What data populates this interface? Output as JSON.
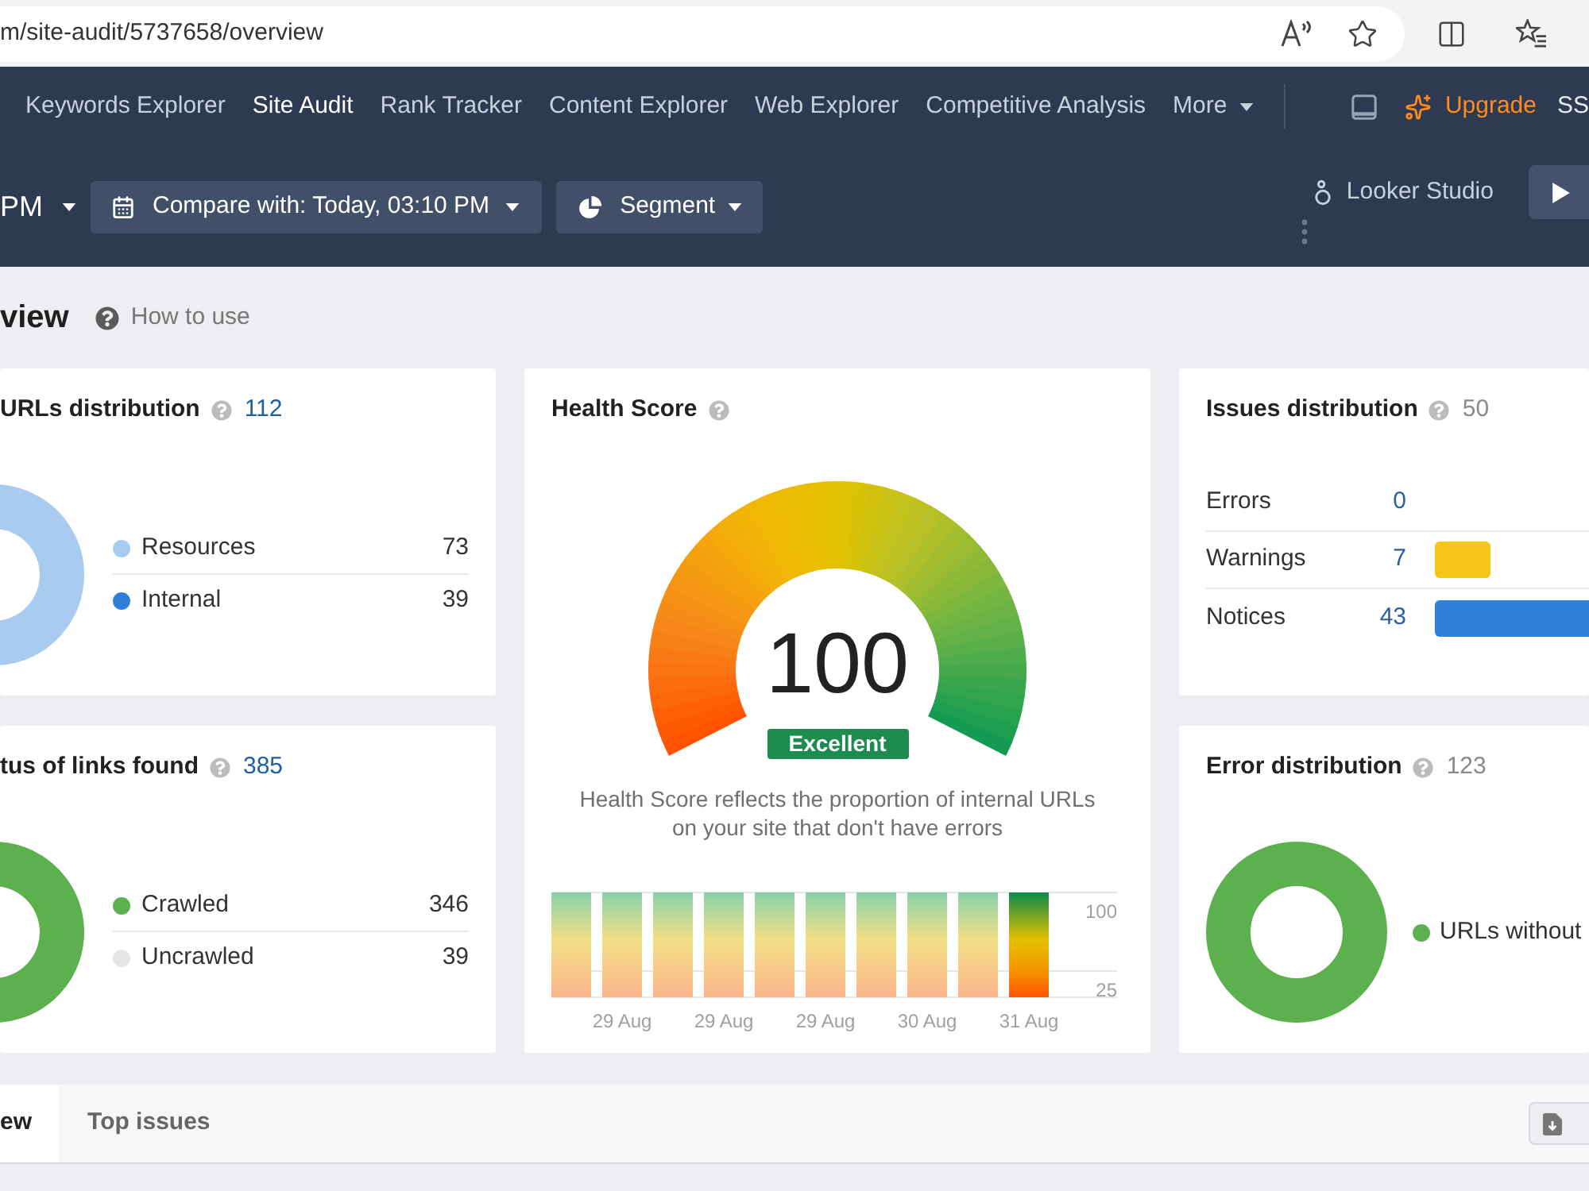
{
  "browser": {
    "url": "m/site-audit/5737658/overview"
  },
  "nav": {
    "items": [
      {
        "label": "Keywords Explorer",
        "kind": "link",
        "selected": false
      },
      {
        "label": "Site Audit",
        "kind": "link",
        "selected": true
      },
      {
        "label": "Rank Tracker",
        "kind": "link",
        "selected": false
      },
      {
        "label": "Content Explorer",
        "kind": "link",
        "selected": false
      },
      {
        "label": "Web Explorer",
        "kind": "link",
        "selected": false
      },
      {
        "label": "Competitive Analysis",
        "kind": "link",
        "selected": false
      },
      {
        "label": "More",
        "kind": "menu",
        "selected": false
      }
    ],
    "upgrade": "Upgrade",
    "account": "SS"
  },
  "toolbar": {
    "date": "PM",
    "compare": "Compare with: Today, 03:10 PM",
    "segment": "Segment",
    "looker": "Looker Studio"
  },
  "page": {
    "title": "view",
    "help": "How to use"
  },
  "urls_distribution": {
    "title": "URLs distribution",
    "count": "112",
    "count_link": true,
    "legend": [
      {
        "label": "Resources",
        "count": "73",
        "color": "#a8cbef"
      },
      {
        "label": "Internal",
        "count": "39",
        "color": "#2d7fd8"
      }
    ]
  },
  "health_score": {
    "title": "Health Score",
    "score": "100",
    "rating": "Excellent",
    "description": "Health Score reflects the proportion of internal URLs on your site that don't have errors",
    "chart_data": {
      "type": "bar",
      "categories": [
        null,
        "29 Aug",
        null,
        "29 Aug",
        null,
        "29 Aug",
        null,
        "30 Aug",
        null,
        "31 Aug"
      ],
      "values": [
        100,
        100,
        100,
        100,
        100,
        100,
        100,
        100,
        100,
        100
      ],
      "ylim": [
        0,
        100
      ],
      "yticks": [
        100,
        25
      ]
    }
  },
  "issues_distribution": {
    "title": "Issues distribution",
    "count": "50",
    "count_link": false,
    "rows": [
      {
        "label": "Errors",
        "count": "0"
      },
      {
        "label": "Warnings",
        "count": "7",
        "color": "#f6c518"
      },
      {
        "label": "Notices",
        "count": "43",
        "color": "#2f80d8"
      }
    ]
  },
  "links_status": {
    "title": "tus of links found",
    "count": "385",
    "count_link": true,
    "legend": [
      {
        "label": "Crawled",
        "count": "346",
        "color": "#5cb04d"
      },
      {
        "label": "Uncrawled",
        "count": "39",
        "color": "#e6e6e6"
      }
    ]
  },
  "error_distribution": {
    "title": "Error distribution",
    "count": "123",
    "count_link": false,
    "legend": [
      {
        "label": "URLs without",
        "color": "#5cb04d"
      }
    ]
  },
  "tabs": [
    {
      "label": "ew",
      "selected": true
    },
    {
      "label": "Top issues",
      "selected": false
    }
  ]
}
